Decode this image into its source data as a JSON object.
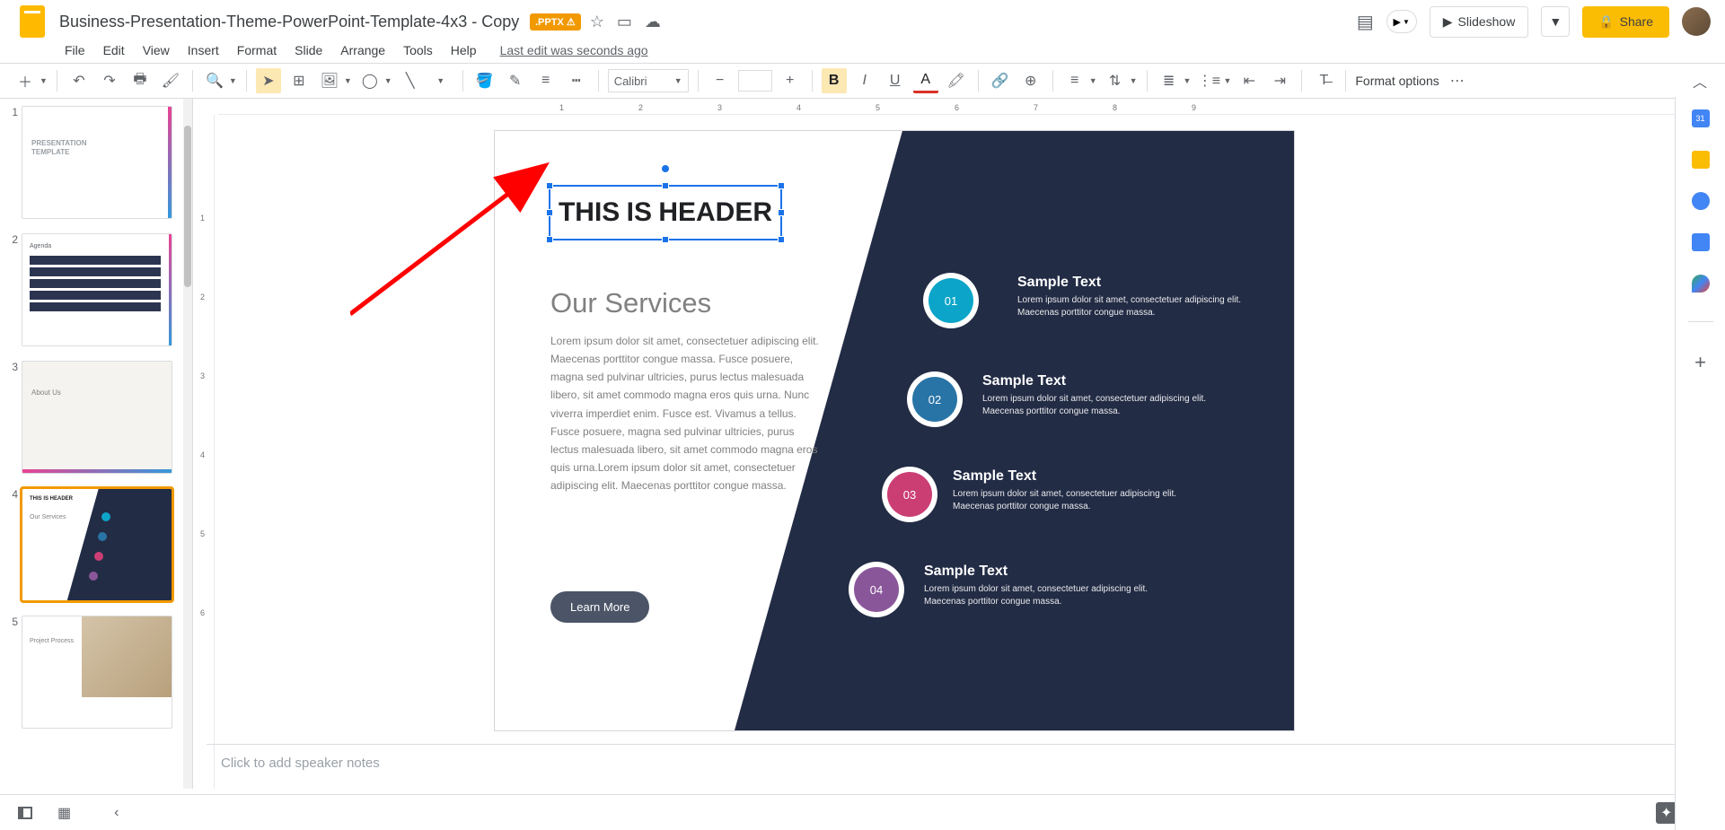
{
  "app": {
    "title": "Business-Presentation-Theme-PowerPoint-Template-4x3 - Copy",
    "badge": ".PPTX ⚠"
  },
  "menu": {
    "file": "File",
    "edit": "Edit",
    "view": "View",
    "insert": "Insert",
    "format": "Format",
    "slide": "Slide",
    "arrange": "Arrange",
    "tools": "Tools",
    "help": "Help",
    "lastedit": "Last edit was seconds ago"
  },
  "header": {
    "slideshow": "Slideshow",
    "share": "Share"
  },
  "toolbar": {
    "font": "Calibri",
    "formatopts": "Format options"
  },
  "thumbs": {
    "n1": "1",
    "n2": "2",
    "n3": "3",
    "n4": "4",
    "n5": "5",
    "t1_line1": "PRESENTATION",
    "t1_line2": "TEMPLATE",
    "t2_title": "Agenda",
    "t3_title": "About Us",
    "t4_header": "THIS IS HEADER",
    "t4_serv": "Our Services",
    "t5_title": "Project Process"
  },
  "slide": {
    "header": "THIS IS HEADER",
    "title": "Our Services",
    "body": "Lorem ipsum dolor sit amet, consectetuer adipiscing elit. Maecenas porttitor congue massa. Fusce posuere, magna sed pulvinar ultricies, purus lectus malesuada libero, sit amet commodo magna eros quis urna. Nunc viverra imperdiet enim. Fusce est. Vivamus a tellus. Fusce posuere, magna sed pulvinar ultricies, purus lectus malesuada libero, sit amet commodo magna eros quis urna.Lorem ipsum dolor sit amet, consectetuer adipiscing elit. Maecenas porttitor congue massa.",
    "learn": "Learn More",
    "n1": "01",
    "n2": "02",
    "n3": "03",
    "n4": "04",
    "samp_h": "Sample Text",
    "samp_p": "Lorem ipsum dolor sit amet, consectetuer adipiscing elit. Maecenas porttitor congue massa."
  },
  "notes": {
    "placeholder": "Click to add speaker notes"
  },
  "ruler": {
    "r1": "1",
    "r2": "2",
    "r3": "3",
    "r4": "4",
    "r5": "5",
    "r6": "6",
    "r7": "7",
    "r8": "8",
    "r9": "9",
    "v1": "1",
    "v2": "2",
    "v3": "3",
    "v4": "4",
    "v5": "5",
    "v6": "6"
  }
}
